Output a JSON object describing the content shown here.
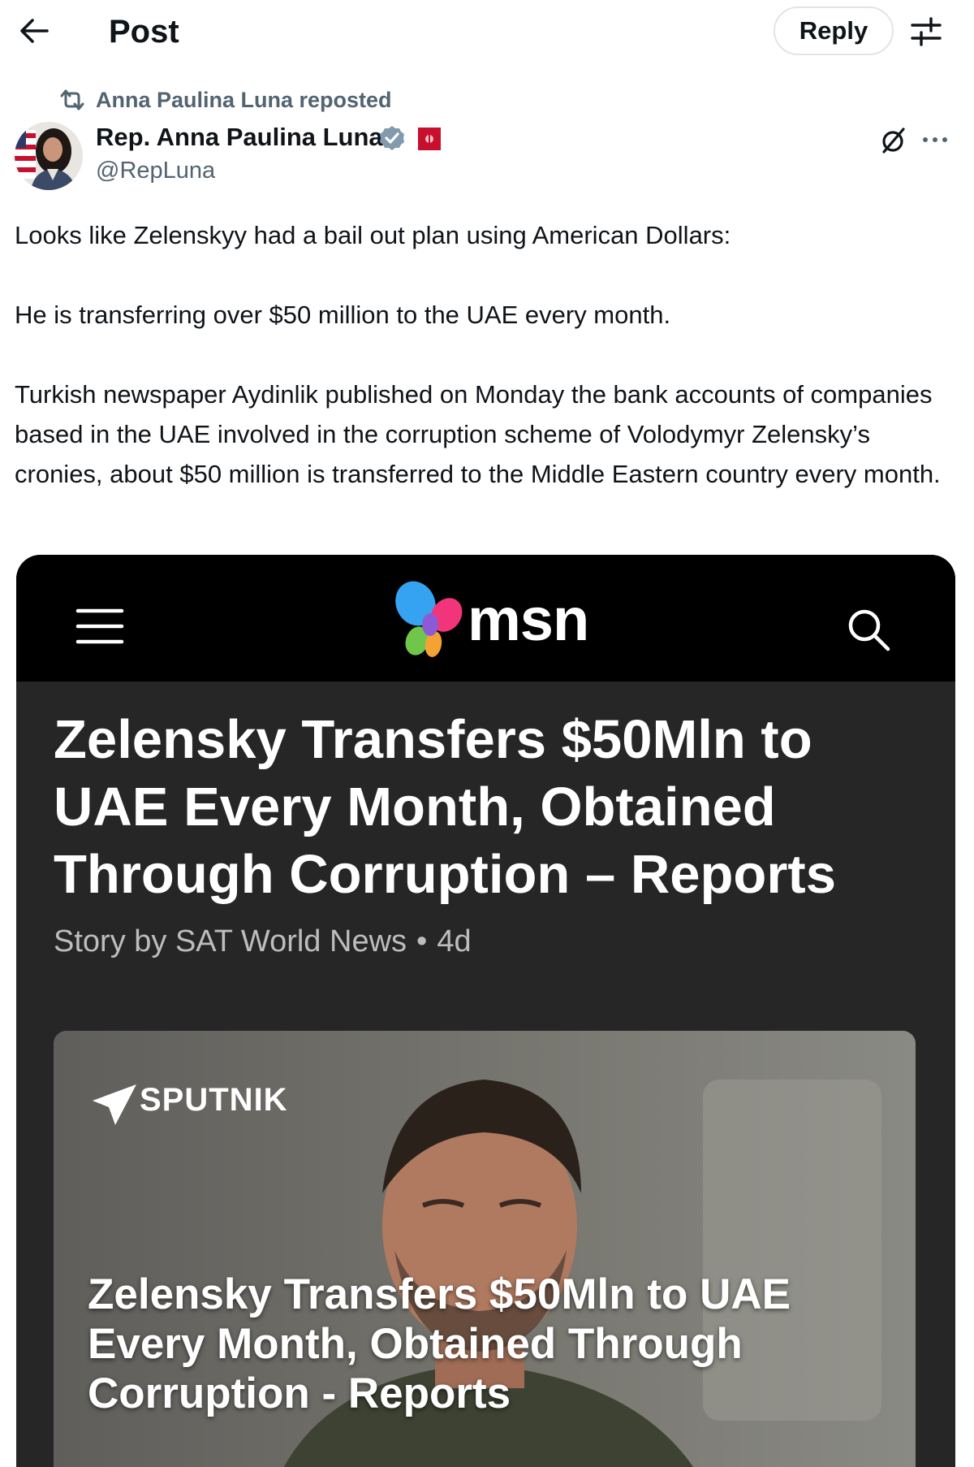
{
  "header": {
    "title": "Post",
    "reply_label": "Reply",
    "back_icon": "arrow-left-icon",
    "filter_icon": "sliders-icon"
  },
  "repost": {
    "text": "Anna Paulina Luna reposted",
    "icon": "repost-icon"
  },
  "author": {
    "name": "Rep. Anna Paulina Luna",
    "handle": "@RepLuna",
    "verified_color": "#829aab",
    "affiliation_color": "#c8102e"
  },
  "tweet": {
    "paragraphs": [
      "Looks like Zelenskyy had a bail out plan using American Dollars:",
      "He is transferring over $50 million to the UAE every month.",
      "Turkish newspaper Aydinlik published on Monday the bank accounts of companies based in the UAE involved in the corruption scheme of Volodymyr Zelensky’s cronies, about $50 million is transferred to the Middle Eastern country every month."
    ]
  },
  "media": {
    "site_name": "msn",
    "headline": "Zelensky Transfers $50Mln to UAE Every Month, Obtained Through Corruption – Reports",
    "byline_source": "Story by SAT World News",
    "byline_age": "4d",
    "image_brand": "SPUTNIK",
    "image_caption": "Zelensky Transfers $50Mln to UAE Every Month, Obtained Through Corruption - Reports"
  },
  "colors": {
    "text_primary": "#0f1419",
    "text_secondary": "#536471",
    "msn_bar": "#000000",
    "article_bg": "#262626"
  }
}
